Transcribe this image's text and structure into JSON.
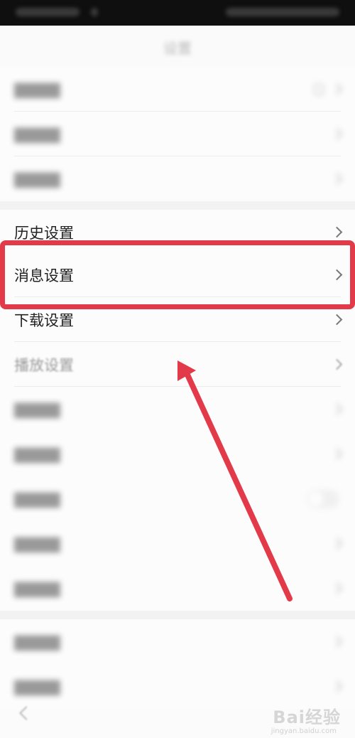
{
  "header": {
    "title": "设置"
  },
  "settings": {
    "history": "历史设置",
    "message": "消息设置",
    "download": "下载设置",
    "playback": "播放设置"
  },
  "annotation": {
    "highlight_color": "#e23a48",
    "arrow_color": "#e23a48"
  },
  "watermark": {
    "text": "Bai经验",
    "sub": "jingyan.baidu.com"
  }
}
